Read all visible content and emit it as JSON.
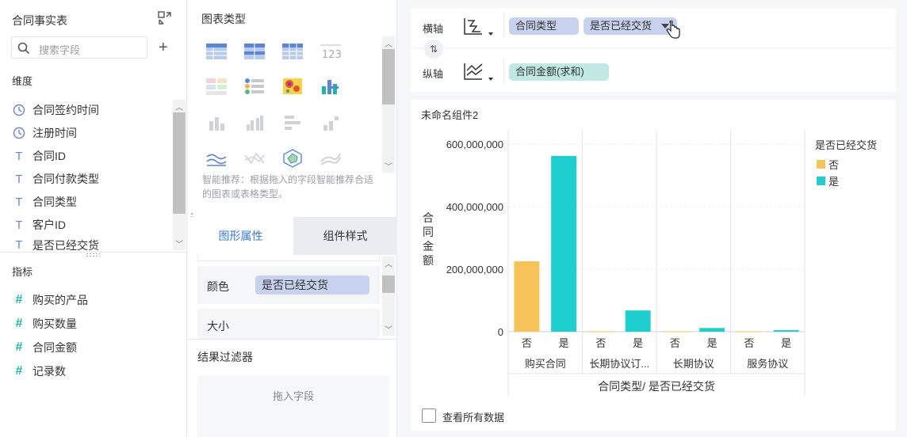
{
  "left_panel": {
    "title": "合同事实表",
    "search_placeholder": "搜索字段",
    "dimensions_label": "维度",
    "dimensions": [
      {
        "icon": "clock-icon",
        "label": "合同签约时间"
      },
      {
        "icon": "clock-icon",
        "label": "注册时间"
      },
      {
        "icon": "text-type-icon",
        "label": "合同ID"
      },
      {
        "icon": "text-type-icon",
        "label": "合同付款类型"
      },
      {
        "icon": "text-type-icon",
        "label": "合同类型"
      },
      {
        "icon": "text-type-icon",
        "label": "客户ID"
      },
      {
        "icon": "text-type-icon",
        "label": "是否已经交货"
      }
    ],
    "measures_label": "指标",
    "measures": [
      {
        "icon": "number-type-icon",
        "label": "购买的产品"
      },
      {
        "icon": "number-type-icon",
        "label": "购买数量"
      },
      {
        "icon": "number-type-icon",
        "label": "合同金额"
      },
      {
        "icon": "record-count-icon",
        "label": "记录数"
      }
    ]
  },
  "middle_panel": {
    "title": "图表类型",
    "tip": "智能推荐：根据拖入的字段智能推荐合适的图表或表格类型。",
    "tabs": [
      "图形属性",
      "组件样式"
    ],
    "color_label": "颜色",
    "color_field": "是否已经交货",
    "size_label": "大小",
    "filter_title": "结果过滤器",
    "drop_hint": "拖入字段"
  },
  "axis_panel": {
    "x_label": "横轴",
    "x_fields": [
      "合同类型",
      "是否已经交货"
    ],
    "y_label": "纵轴",
    "y_fields": [
      "合同金额(求和)"
    ]
  },
  "chart_panel": {
    "title": "未命名组件2",
    "show_all_label": "查看所有数据"
  },
  "colors": {
    "no": "#f6c35a",
    "yes": "#1fcfd0",
    "accent": "#3a79d6"
  },
  "chart_data": {
    "type": "bar",
    "groups": [
      "购买合同",
      "长期协议订...",
      "长期协议",
      "服务协议"
    ],
    "sub_categories": [
      "否",
      "是"
    ],
    "series": [
      {
        "name": "否",
        "values": [
          225000000,
          1000000,
          1000000,
          1000000
        ]
      },
      {
        "name": "是",
        "values": [
          562000000,
          68000000,
          12000000,
          5000000
        ]
      }
    ],
    "ylim": [
      0,
      610000000
    ],
    "yticks": [
      "600,000,000",
      "400,000,000",
      "200,000,000",
      "0"
    ],
    "ytick_values": [
      600000000,
      400000000,
      200000000,
      0
    ],
    "ylabel": "合同金额",
    "xlabel": "合同类型/ 是否已经交货",
    "legend_title": "是否已经交货",
    "legend": [
      "否",
      "是"
    ],
    "legend_position": "right",
    "grid": true
  }
}
